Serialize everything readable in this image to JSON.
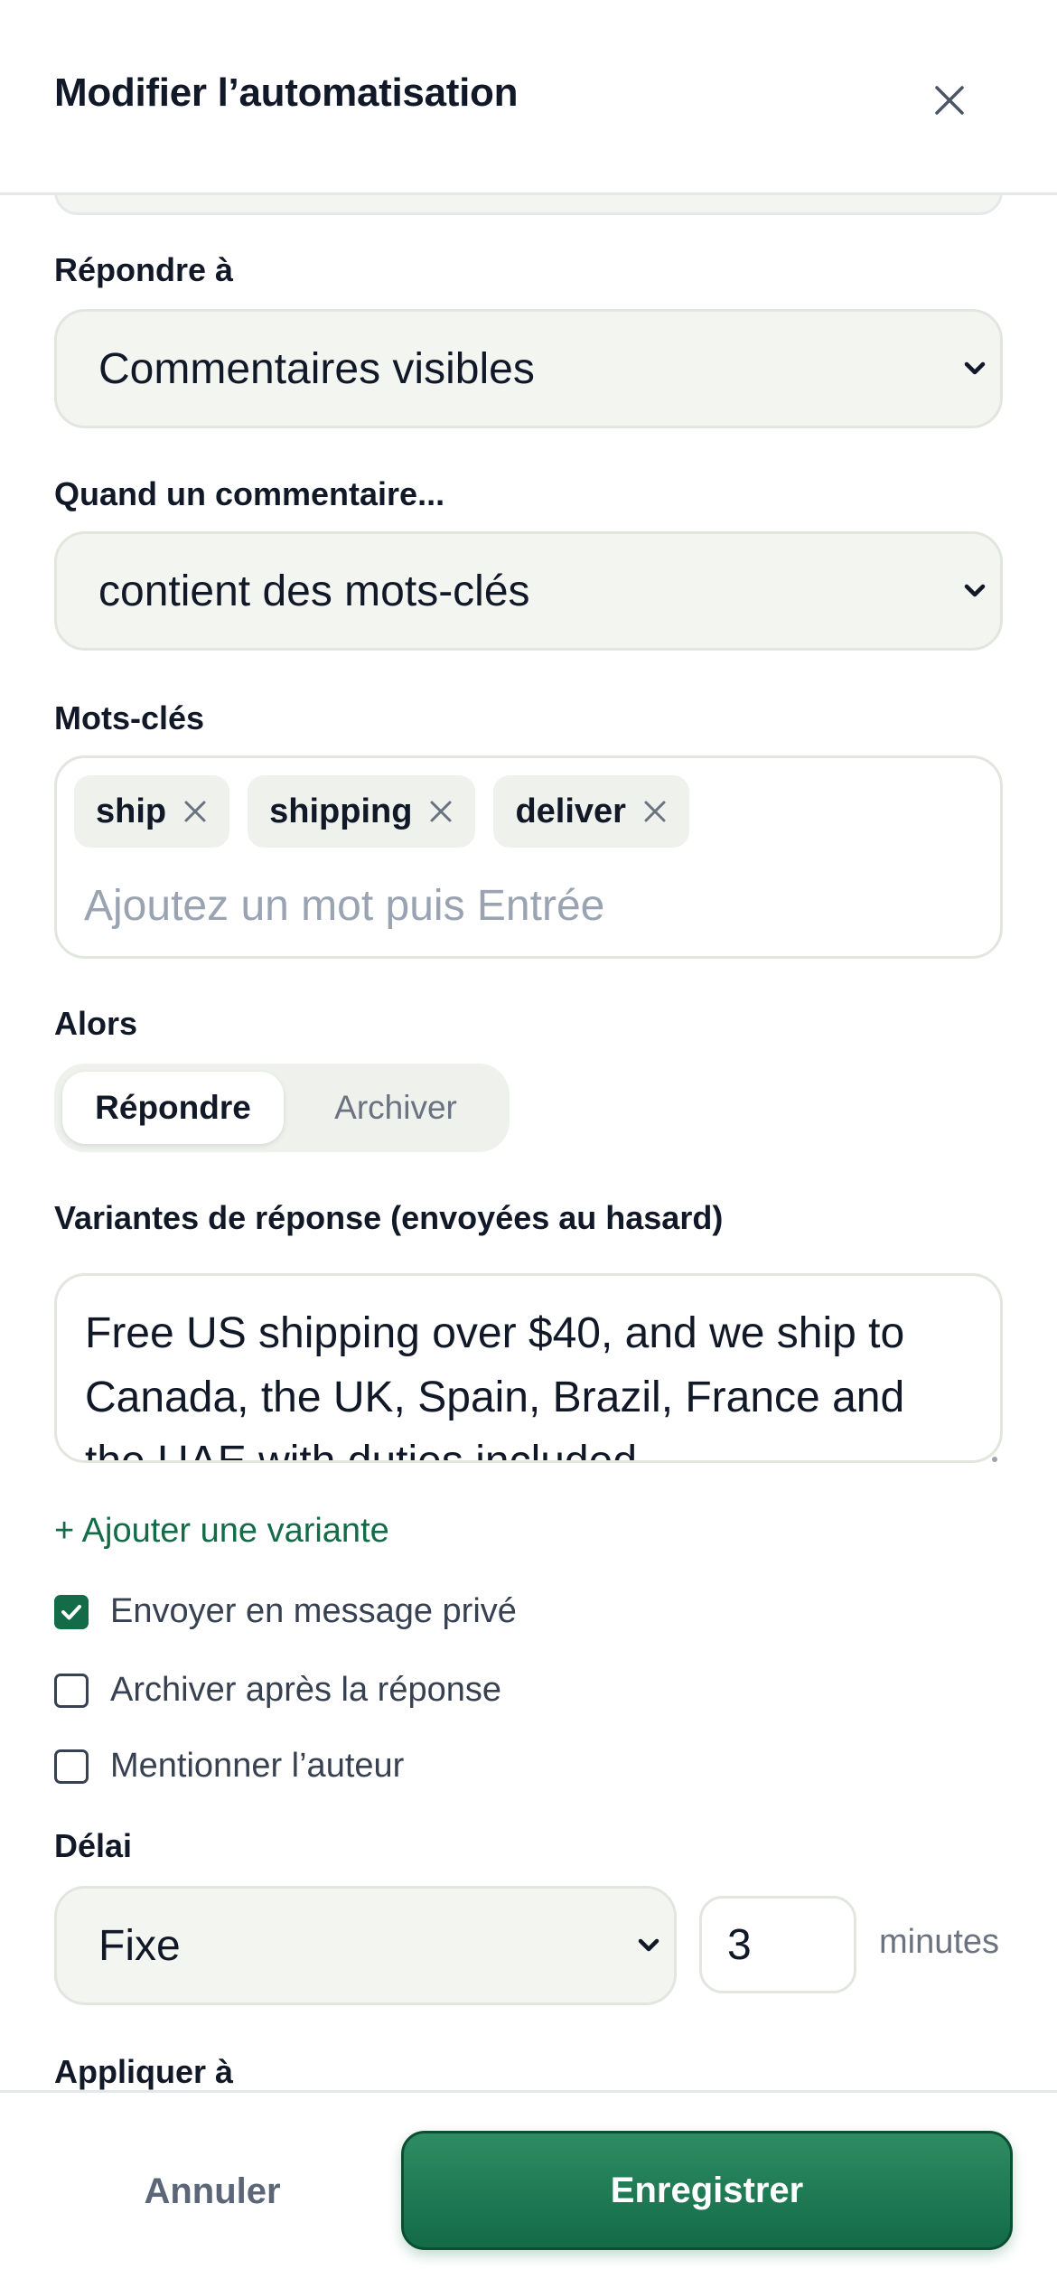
{
  "header": {
    "title": "Modifier l’automatisation",
    "close_icon": "close-icon"
  },
  "reply_to": {
    "label": "Répondre à",
    "selected": "Commentaires visibles"
  },
  "when_comment": {
    "label": "Quand un commentaire...",
    "selected": "contient des mots-clés"
  },
  "keywords": {
    "label": "Mots-clés",
    "chips": [
      "ship",
      "shipping",
      "deliver"
    ],
    "input_placeholder": "Ajoutez un mot puis Entrée",
    "input_value": ""
  },
  "then": {
    "label": "Alors",
    "options": [
      "Répondre",
      "Archiver"
    ],
    "selected": "Répondre"
  },
  "variants": {
    "label": "Variantes de réponse (envoyées au hasard)",
    "text": "Free US shipping over $40, and we ship to Canada, the UK, Spain, Brazil, France and the UAE with duties included.",
    "add_label": "+ Ajouter une variante"
  },
  "options": [
    {
      "label": "Envoyer en message privé",
      "checked": true
    },
    {
      "label": "Archiver après la réponse",
      "checked": false
    },
    {
      "label": "Mentionner l’auteur",
      "checked": false
    }
  ],
  "delay": {
    "label": "Délai",
    "selected": "Fixe",
    "value": "3",
    "unit": "minutes"
  },
  "apply_to": {
    "label": "Appliquer à"
  },
  "footer": {
    "cancel_label": "Annuler",
    "save_label": "Enregistrer"
  },
  "colors": {
    "accent": "#136b48",
    "field_bg": "#f3f5f1",
    "border": "#e2e6df"
  }
}
